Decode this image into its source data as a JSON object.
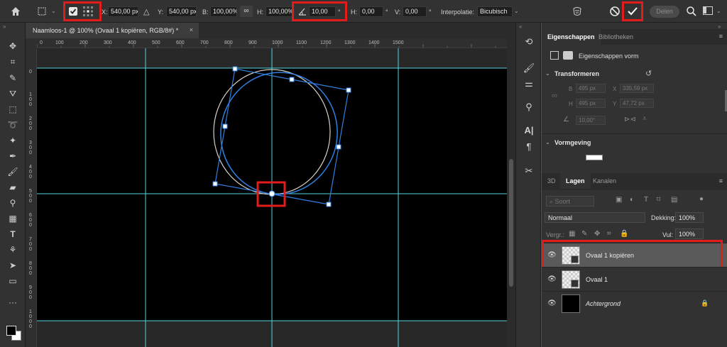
{
  "options_bar": {
    "x_label": "X:",
    "x_value": "540,00 px",
    "y_label": "Y:",
    "y_value": "540,00 px",
    "w_label": "B:",
    "w_value": "100,00%",
    "h_label": "H:",
    "h_value": "100,00%",
    "angle_value": "10,00",
    "angle_unit": "°",
    "hskew_label": "H:",
    "hskew_value": "0,00",
    "hskew_unit": "°",
    "vskew_label": "V:",
    "vskew_value": "0,00",
    "vskew_unit": "°",
    "interp_label": "Interpolatie:",
    "interp_value": "Bicubisch",
    "share_label": "Delen"
  },
  "document": {
    "tab_title": "Naamloos-1 @ 100% (Ovaal 1 kopiëren, RGB/8#) *",
    "close_icon": "×"
  },
  "ruler": {
    "top_ticks": [
      "0",
      "100",
      "200",
      "300",
      "400",
      "500",
      "600",
      "700",
      "800",
      "900",
      "1000",
      "1100",
      "1200",
      "1300",
      "1400",
      "1500"
    ],
    "left_ticks": [
      "0",
      "100",
      "200",
      "300",
      "400",
      "500",
      "600",
      "700",
      "800",
      "900",
      "1000"
    ]
  },
  "properties_panel": {
    "tab_properties": "Eigenschappen",
    "tab_libraries": "Bibliotheken",
    "shape_label": "Eigenschappen vorm",
    "transform_title": "Transformeren",
    "w_label": "B",
    "w_value": "495 px",
    "x_label": "X",
    "x_value": "335,59 px",
    "h_label": "H",
    "h_value": "495 px",
    "y_label": "Y",
    "y_value": "47,72 px",
    "angle_value": "10,00°",
    "appearance_title": "Vormgeving"
  },
  "layers_panel": {
    "tab_3d": "3D",
    "tab_layers": "Lagen",
    "tab_channels": "Kanalen",
    "search_placeholder": "Soort",
    "blend_mode": "Normaal",
    "opacity_label": "Dekking:",
    "opacity_value": "100%",
    "lock_label": "Vergr.:",
    "fill_label": "Vul:",
    "fill_value": "100%",
    "layers": [
      {
        "name": "Ovaal 1 kopiëren"
      },
      {
        "name": "Ovaal 1"
      },
      {
        "name": "Achtergrond"
      }
    ]
  },
  "colors": {
    "highlight": "#e21b1b",
    "guide": "#4fd3e0",
    "path": "#2f7fe0"
  }
}
